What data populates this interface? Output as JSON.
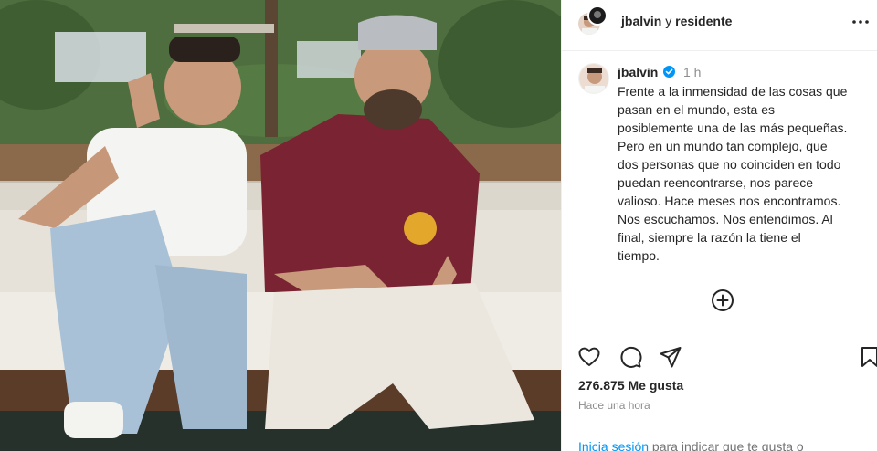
{
  "header": {
    "user1": "jbalvin",
    "connector": "y",
    "user2": "residente",
    "more_icon": "more-horizontal-icon"
  },
  "post": {
    "author": "jbalvin",
    "verified": true,
    "time_ago": "1 h",
    "caption_lines": [
      "Frente a la inmensidad de las cosas que",
      "pasan en el mundo, esta es",
      "posiblemente una de las más pequeñas.",
      "Pero en un mundo tan complejo, que",
      "dos personas que no coinciden en todo",
      "puedan reencontrarse, nos parece",
      "valioso. Hace meses nos encontramos.",
      "Nos escuchamos. Nos entendimos. Al",
      "final, siempre la razón la tiene el",
      "tiempo."
    ],
    "more_comments_icon": "plus-circle-icon"
  },
  "actions": {
    "icons": [
      "heart-icon",
      "comment-icon",
      "share-icon",
      "bookmark-icon"
    ]
  },
  "likes_text": "276.875 Me gusta",
  "posted_ago": "Hace una hora",
  "footer": {
    "login_link": "Inicia sesión",
    "login_rest": " para indicar que te gusta o"
  },
  "colors": {
    "link_blue": "#0095f6",
    "verified_blue": "#0095f6",
    "muted": "#8e8e8e",
    "text": "#262626"
  }
}
